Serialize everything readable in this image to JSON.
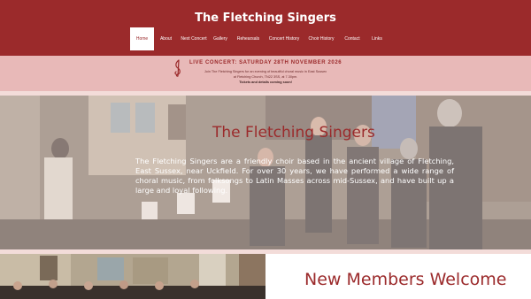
{
  "header": {
    "title": "The Fletching Singers",
    "nav": [
      "Home",
      "About",
      "Next Concert",
      "Gallery",
      "Rehearsals",
      "Concert History",
      "Choir History",
      "Contact",
      "Links"
    ],
    "active_index": 0
  },
  "announcement": {
    "title": "LIVE CONCERT: SATURDAY 28TH NOVEMBER 2026",
    "line1": "Join The Fletching Singers for an evening of beautiful choral music in East Sussex",
    "line2": "at Fletching Church, TN22 3SS, at 7.30pm.",
    "line3": "Tickets and details coming soon!",
    "icon": "treble-clef-icon"
  },
  "hero": {
    "title": "The Fletching Singers",
    "body": "The Fletching Singers are a friendly choir based in the ancient village of Fletching, East Sussex, near Uckfield. For over 30 years, we have performed a wide range of choral music, from folksongs to Latin Masses across mid-Sussex, and have built up a large and loyal following."
  },
  "section": {
    "heading": "New Members Welcome"
  },
  "colors": {
    "brand": "#9b2a2b",
    "announce_bg": "#e8b9b8",
    "band": "#f3dcd9"
  }
}
